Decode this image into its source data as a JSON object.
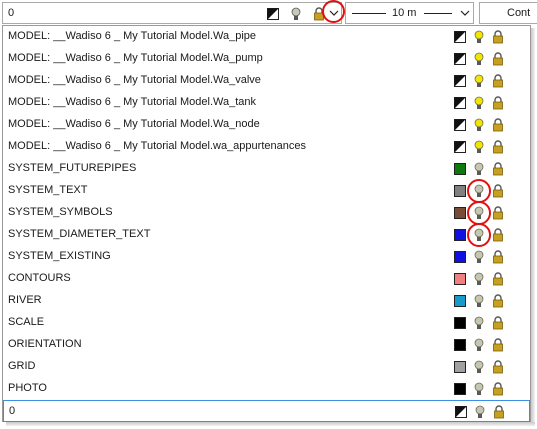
{
  "toolbar": {
    "layer_value": "0",
    "width_value": "10 m",
    "cont_label": "Cont",
    "icons": [
      "color-swatch-icon",
      "lightbulb-icon",
      "padlock-icon",
      "chevron-down-icon"
    ]
  },
  "layers": [
    {
      "label": "MODEL: __Wadiso 6 _ My Tutorial Model.Wa_pipe",
      "color": "diag",
      "bulb": "on",
      "ring": false
    },
    {
      "label": "MODEL: __Wadiso 6 _ My Tutorial Model.Wa_pump",
      "color": "diag",
      "bulb": "on",
      "ring": false
    },
    {
      "label": "MODEL: __Wadiso 6 _ My Tutorial Model.Wa_valve",
      "color": "diag",
      "bulb": "on",
      "ring": false
    },
    {
      "label": "MODEL: __Wadiso 6 _ My Tutorial Model.Wa_tank",
      "color": "diag",
      "bulb": "on",
      "ring": false
    },
    {
      "label": "MODEL: __Wadiso 6 _ My Tutorial Model.Wa_node",
      "color": "diag",
      "bulb": "on",
      "ring": false
    },
    {
      "label": "MODEL: __Wadiso 6 _ My Tutorial Model.wa_appurtenances",
      "color": "diag",
      "bulb": "on",
      "ring": false
    },
    {
      "label": "SYSTEM_FUTUREPIPES",
      "color": "#0e7a0e",
      "bulb": "off",
      "ring": false
    },
    {
      "label": "SYSTEM_TEXT",
      "color": "#808080",
      "bulb": "off",
      "ring": true
    },
    {
      "label": "SYSTEM_SYMBOLS",
      "color": "#7a4b36",
      "bulb": "off",
      "ring": true
    },
    {
      "label": "SYSTEM_DIAMETER_TEXT",
      "color": "#1010e0",
      "bulb": "off",
      "ring": true
    },
    {
      "label": "SYSTEM_EXISTING",
      "color": "#1010e0",
      "bulb": "off",
      "ring": false
    },
    {
      "label": "CONTOURS",
      "color": "#f08080",
      "bulb": "off",
      "ring": false
    },
    {
      "label": "RIVER",
      "color": "#1a9ac8",
      "bulb": "off",
      "ring": false
    },
    {
      "label": "SCALE",
      "color": "#000000",
      "bulb": "off",
      "ring": false
    },
    {
      "label": "ORIENTATION",
      "color": "#000000",
      "bulb": "off",
      "ring": false
    },
    {
      "label": "GRID",
      "color": "#a0a0a0",
      "bulb": "off",
      "ring": false
    },
    {
      "label": "PHOTO",
      "color": "#000000",
      "bulb": "off",
      "ring": false
    },
    {
      "label": "0",
      "color": "diag",
      "bulb": "off",
      "ring": false,
      "selected": true
    }
  ],
  "colors": {
    "ring": "#e01010",
    "bulb_on": "#f2e600",
    "lock": "#c8a020",
    "selection_border": "#3a8ee6"
  }
}
